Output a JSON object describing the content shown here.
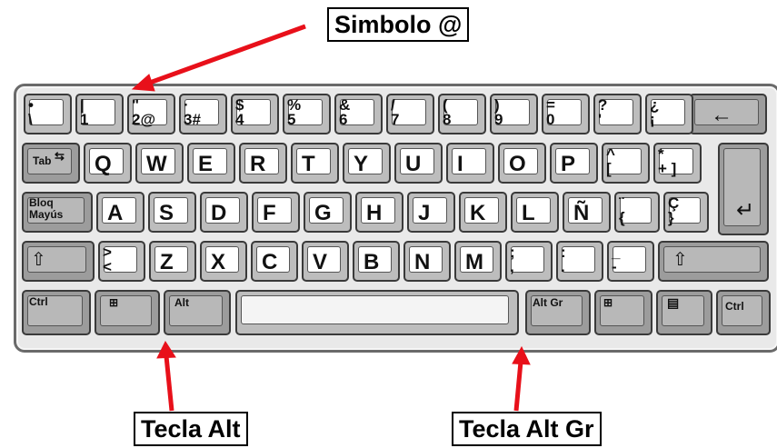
{
  "labels": {
    "symbol": "Simbolo @",
    "alt": "Tecla Alt",
    "altgr": "Tecla Alt Gr"
  },
  "keys": {
    "row1": [
      {
        "top": "•",
        "bottom": "\\"
      },
      {
        "top": "|",
        "bottom": "1"
      },
      {
        "top": "\"",
        "bottom": "2@"
      },
      {
        "top": "·",
        "bottom": "3#"
      },
      {
        "top": "$",
        "bottom": "4"
      },
      {
        "top": "%",
        "bottom": "5"
      },
      {
        "top": "&",
        "bottom": "6"
      },
      {
        "top": "/",
        "bottom": "7"
      },
      {
        "top": "(",
        "bottom": "8"
      },
      {
        "top": ")",
        "bottom": "9"
      },
      {
        "top": "=",
        "bottom": "0"
      },
      {
        "top": "?",
        "bottom": "'"
      },
      {
        "top": "¿",
        "bottom": "¡"
      }
    ],
    "backspace": "←",
    "tab": "Tab",
    "row2": [
      "Q",
      "W",
      "E",
      "R",
      "T",
      "Y",
      "U",
      "I",
      "O",
      "P"
    ],
    "row2_extra": [
      {
        "top": "^",
        "bottom": "["
      },
      {
        "top": "*",
        "bottom": "+ ]"
      }
    ],
    "bloq_top": "Bloq",
    "bloq_bottom": "Mayús",
    "row3": [
      "A",
      "S",
      "D",
      "F",
      "G",
      "H",
      "J",
      "K",
      "L",
      "Ñ"
    ],
    "row3_extra": [
      {
        "top": "¨",
        "bottom": "{"
      },
      {
        "top": "Ç",
        "bottom": "}"
      }
    ],
    "enter": "↵",
    "shift_left": "⇧",
    "row4_angle": {
      "top": ">",
      "bottom": "<"
    },
    "row4": [
      "Z",
      "X",
      "C",
      "V",
      "B",
      "N",
      "M"
    ],
    "row4_extra": [
      {
        "top": ";",
        "bottom": ","
      },
      {
        "top": ":",
        "bottom": "."
      },
      {
        "top": "_",
        "bottom": "-"
      }
    ],
    "shift_right": "⇧",
    "ctrl_left": "Ctrl",
    "win_left": "⊞",
    "alt": "Alt",
    "altgr": "Alt Gr",
    "win_right": "⊞",
    "menu": "▤",
    "ctrl_right": "Ctrl"
  },
  "colors": {
    "arrow": "#e8101a",
    "key_base": "#bdbdbd",
    "board": "#e9e9e9"
  }
}
